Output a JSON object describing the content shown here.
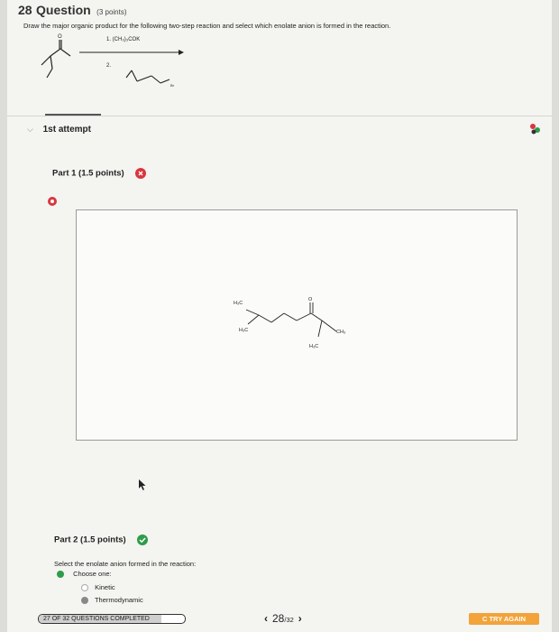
{
  "question": {
    "number": "28",
    "word": "Question",
    "points": "(3 points)",
    "prompt": "Draw the major organic product for the following two-step reaction and select which enolate anion is formed in the reaction."
  },
  "reaction": {
    "step1": "1. (CH₃)₃COK",
    "step2": "2.",
    "substituent": "Br"
  },
  "attempt": {
    "label": "1st attempt"
  },
  "part1": {
    "label": "Part 1",
    "points": "(1.5 points)",
    "status": "incorrect"
  },
  "product_labels": {
    "h3c_a": "H₃C",
    "h3c_b": "H₃C",
    "ch3": "CH₃",
    "h3c_c": "H₃C",
    "o": "O"
  },
  "part2": {
    "label": "Part 2",
    "points": "(1.5 points)",
    "status": "correct",
    "instruction": "Select the enolate anion formed in the reaction:",
    "choose": "Choose one:",
    "options": [
      "Kinetic",
      "Thermodynamic"
    ],
    "selected_option": "Thermodynamic"
  },
  "footer": {
    "progress_text": "27 OF 32 QUESTIONS COMPLETED",
    "progress_fraction": 0.84,
    "current_page": "28",
    "total_pages": "/32",
    "try_again": "C TRY AGAIN"
  },
  "colors": {
    "error": "#d9363e",
    "success": "#2e9c4a",
    "accent": "#f2a33a"
  },
  "icons": {
    "attempt_chevron": "chevron-down-icon",
    "error": "x-circle-icon",
    "success": "check-circle-icon",
    "prev": "chevron-left-icon",
    "next": "chevron-right-icon"
  }
}
